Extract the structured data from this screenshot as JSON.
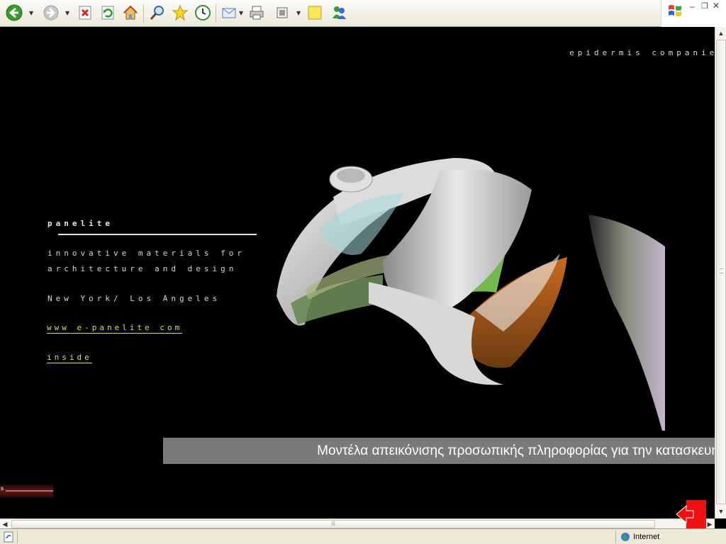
{
  "site": {
    "brand": "epidermis companies",
    "heading": "panelite",
    "tagline_line1": "innovative materials for",
    "tagline_line2": "architecture and design",
    "location": "New York/ Los Angeles",
    "website_link": "www e-panelite com",
    "inside_link": "inside",
    "corner_label": "s"
  },
  "caption": {
    "text": "Μοντέλα απεικόνισης προσωπικής πληροφορίας για την κατασκευή"
  },
  "statusbar": {
    "zone_label": "Internet"
  },
  "toolbar": {
    "icons": [
      "back-icon",
      "forward-icon",
      "stop-icon",
      "refresh-icon",
      "home-icon",
      "search-icon",
      "favorites-icon",
      "history-icon",
      "mail-icon",
      "print-icon",
      "edit-icon",
      "notes-icon",
      "messenger-icon"
    ]
  },
  "colors": {
    "link": "#cfe638",
    "caption_bg": "#7a7a7a",
    "text": "#d8d8d8"
  }
}
